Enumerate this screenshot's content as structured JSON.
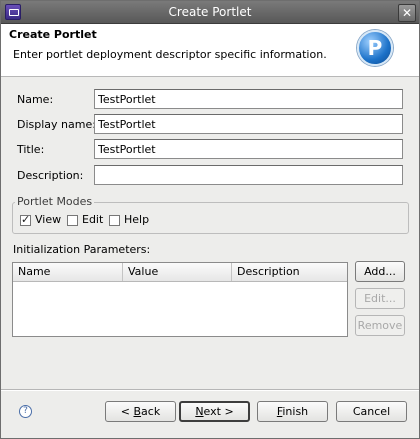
{
  "window": {
    "title": "Create Portlet"
  },
  "banner": {
    "heading": "Create Portlet",
    "description": "Enter portlet deployment descriptor specific information.",
    "logo_letter": "P"
  },
  "form": {
    "name_label": "Name:",
    "name_value": "TestPortlet",
    "display_name_label": "Display name:",
    "display_name_value": "TestPortlet",
    "title_label": "Title:",
    "title_value": "TestPortlet",
    "description_label": "Description:",
    "description_value": ""
  },
  "portlet_modes": {
    "label": "Portlet Modes",
    "modes": [
      {
        "label": "View",
        "checked": true
      },
      {
        "label": "Edit",
        "checked": false
      },
      {
        "label": "Help",
        "checked": false
      }
    ]
  },
  "init_params": {
    "label": "Initialization Parameters:",
    "columns": [
      "Name",
      "Value",
      "Description"
    ],
    "rows": [],
    "add_label": "Add...",
    "edit_label": "Edit...",
    "remove_label": "Remove"
  },
  "footer": {
    "help_glyph": "?",
    "back_prefix": "< ",
    "back_mnemonic": "B",
    "back_rest": "ack",
    "next_mnemonic": "N",
    "next_rest": "ext >",
    "finish_mnemonic": "F",
    "finish_rest": "inish",
    "cancel_label": "Cancel"
  }
}
